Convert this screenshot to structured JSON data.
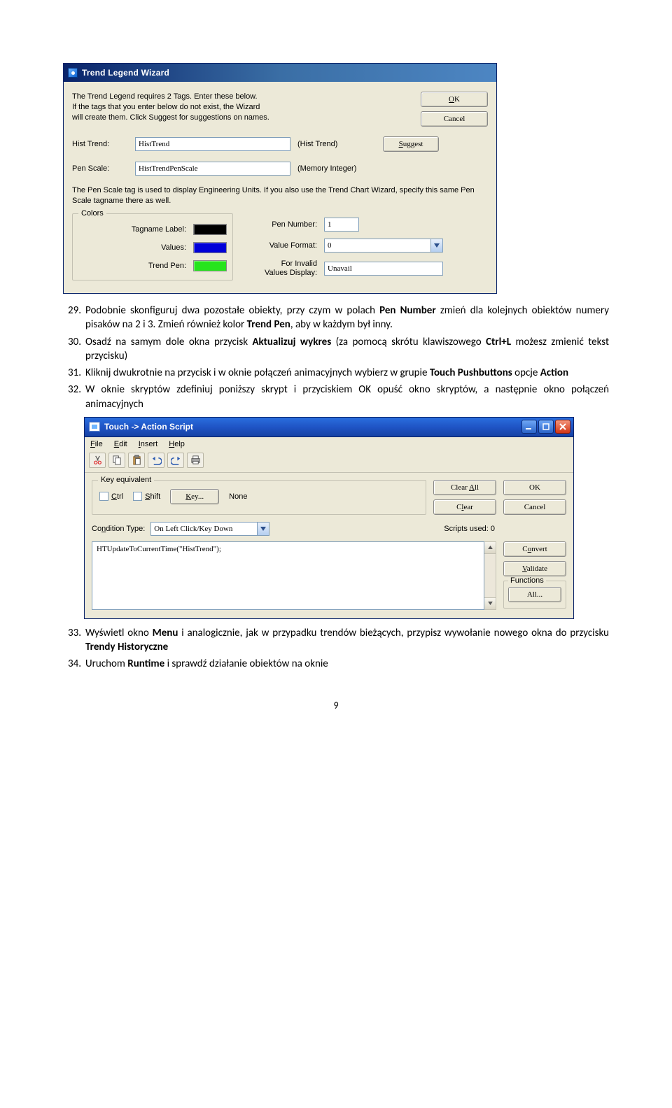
{
  "wizard": {
    "title": "Trend Legend Wizard",
    "intro_line1": "The Trend Legend requires 2 Tags.  Enter these below.",
    "intro_line2": "If the tags that you enter below do not exist, the Wizard",
    "intro_line3": "will create them.  Click Suggest for suggestions on names.",
    "ok": "OK",
    "cancel": "Cancel",
    "suggest": "Suggest",
    "hist_trend_label": "Hist Trend:",
    "hist_trend_value": "HistTrend",
    "hist_trend_type": "(Hist Trend)",
    "pen_scale_label": "Pen Scale:",
    "pen_scale_value": "HistTrendPenScale",
    "pen_scale_type": "(Memory Integer)",
    "note": "The Pen Scale tag is used to display Engineering Units.  If you also use the Trend Chart Wizard, specify this same Pen Scale tagname there as well.",
    "colors_legend": "Colors",
    "tagname_label": "Tagname Label:",
    "values_label": "Values:",
    "trend_pen_label": "Trend Pen:",
    "tagname_color": "#000000",
    "values_color": "#0000d8",
    "trend_pen_color": "#26e41c",
    "pen_number_label": "Pen Number:",
    "pen_number_value": "1",
    "value_format_label": "Value Format:",
    "value_format_value": "0",
    "invalid_label1": "For Invalid",
    "invalid_label2": "Values Display:",
    "invalid_value": "Unavail"
  },
  "doc": {
    "items": [
      {
        "num": "29.",
        "text": "Podobnie skonfiguruj dwa pozostałe obiekty, przy czym w polach Pen Number zmień dla kolejnych obiektów numery pisaków na 2 i 3. Zmień również kolor Trend Pen, aby w każdym był inny.",
        "bold": [
          "Pen Number",
          "Trend Pen"
        ]
      },
      {
        "num": "30.",
        "text": "Osadź na samym dole okna przycisk Aktualizuj wykres (za pomocą skrótu klawiszowego Ctrl+L możesz zmienić tekst przycisku)",
        "bold": [
          "Aktualizuj wykres",
          "Ctrl+L"
        ]
      },
      {
        "num": "31.",
        "text": "Kliknij dwukrotnie na przycisk i w oknie połączeń animacyjnych wybierz w grupie Touch Pushbuttons opcje Action",
        "bold": [
          "Touch Pushbuttons",
          "Action"
        ]
      },
      {
        "num": "32.",
        "text": "W oknie skryptów zdefiniuj poniższy skrypt i przyciskiem OK opuść okno skryptów, a następnie okno połączeń animacyjnych",
        "bold": []
      },
      {
        "num": "33.",
        "text": "Wyświetl okno Menu i analogicznie, jak w przypadku trendów bieżących, przypisz wywołanie nowego okna do przycisku Trendy Historyczne",
        "bold": [
          "Menu",
          "Trendy Historyczne"
        ]
      },
      {
        "num": "34.",
        "text": "Uruchom Runtime i sprawdź działanie obiektów na oknie",
        "bold": [
          "Runtime"
        ]
      }
    ],
    "page_num": "9"
  },
  "script_win": {
    "title": "Touch -> Action Script",
    "menu": {
      "file": "File",
      "edit": "Edit",
      "insert": "Insert",
      "help": "Help"
    },
    "key_legend": "Key equivalent",
    "ctrl_label": "Ctrl",
    "shift_label": "Shift",
    "key_btn": "Key...",
    "key_value": "None",
    "clear_all": "Clear All",
    "clear": "Clear",
    "ok": "OK",
    "cancel": "Cancel",
    "cond_label": "Condition Type:",
    "cond_value": "On Left Click/Key Down",
    "scripts_used": "Scripts used: 0",
    "convert": "Convert",
    "validate": "Validate",
    "functions": "Functions",
    "all": "All...",
    "code": "HTUpdateToCurrentTime(\"HistTrend\");"
  }
}
